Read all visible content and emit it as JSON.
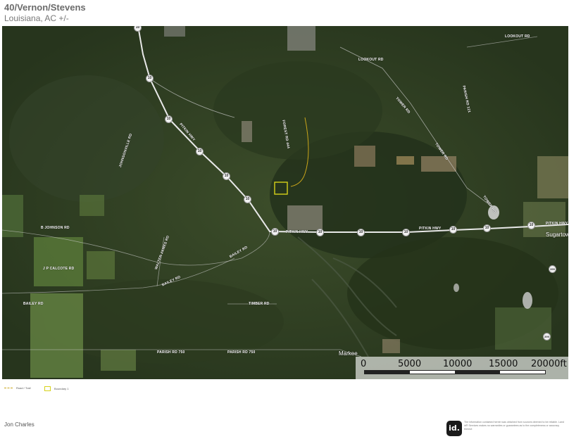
{
  "header": {
    "title": "40/Vernon/Stevens",
    "subtitle": "Louisiana,  AC +/-"
  },
  "map": {
    "road_labels": [
      {
        "id": "lookout-rd-1",
        "text": "LOOKOUT RD"
      },
      {
        "id": "lookout-rd-2",
        "text": "LOOKOUT RD"
      },
      {
        "id": "parish-rd-121",
        "text": "PARISH RD 121"
      },
      {
        "id": "tower-rd-1",
        "text": "TOWER RD"
      },
      {
        "id": "tower-rd-2",
        "text": "TOWER RD"
      },
      {
        "id": "tower-rd-3",
        "text": "TOWER RD"
      },
      {
        "id": "johnsonville-rd",
        "text": "JOHNSONVILLE RD"
      },
      {
        "id": "pitkin-hwy-1",
        "text": "PITKIN HWY"
      },
      {
        "id": "forest-rd-444",
        "text": "FOREST RD 444"
      },
      {
        "id": "pitkin-hwy-2",
        "text": "PITKIN HWY"
      },
      {
        "id": "pitkin-hwy-3",
        "text": "PITKIN HWY"
      },
      {
        "id": "pitkin-hwy-4",
        "text": "PITKIN HWY"
      },
      {
        "id": "b-johnson-rd",
        "text": "B JOHNSON RD"
      },
      {
        "id": "walter-james-rd",
        "text": "WALTER JAMES RD"
      },
      {
        "id": "bailey-rd-1",
        "text": "BAILEY RD"
      },
      {
        "id": "jp-calcote-rd",
        "text": "J P CALCOTE RD"
      },
      {
        "id": "bailey-rd-2",
        "text": "BAILEY RD"
      },
      {
        "id": "bailey-rd-3",
        "text": "BAILEY RD"
      },
      {
        "id": "timber-rd",
        "text": "TIMBER RD"
      },
      {
        "id": "parish-rd-750-1",
        "text": "PARISH RD 750"
      },
      {
        "id": "parish-rd-750-2",
        "text": "PARISH RD 750"
      }
    ],
    "highway_shields": [
      "10",
      "10",
      "10",
      "10",
      "10",
      "10",
      "10",
      "10",
      "10",
      "10",
      "10",
      "10",
      "10",
      "399",
      "399"
    ],
    "towns": [
      {
        "id": "sugartown",
        "text": "Sugartown"
      },
      {
        "id": "markee",
        "text": "Markee"
      }
    ],
    "scale": {
      "labels": [
        "0",
        "5000",
        "10000",
        "15000",
        "20000ft"
      ]
    },
    "colors": {
      "boundary": "#d6d21a",
      "road_trail": "#c9a51a"
    }
  },
  "legend": {
    "road_trail": "Road / Trail",
    "boundary": "Boundary 1"
  },
  "footer": {
    "agent_name": "Jon Charles",
    "brand_mark": "id.",
    "disclaimer": "The information contained herein was obtained from sources deemed to be reliable. Land id® Services makes no warranties or guarantees as to the completeness or accuracy thereof."
  }
}
